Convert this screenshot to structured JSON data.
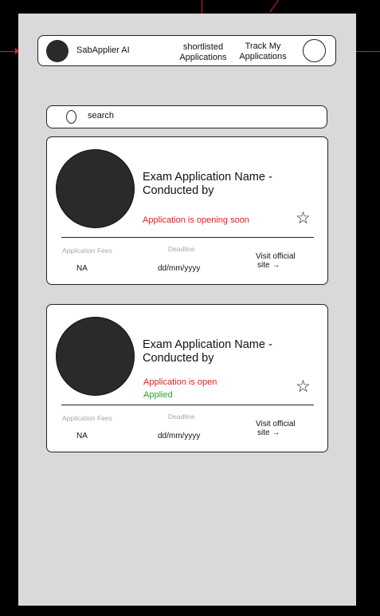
{
  "nav": {
    "brand": "SabApplier AI",
    "link_shortlisted_line1": "shortlisted",
    "link_shortlisted_line2": "Applications",
    "link_track_line1": "Track My",
    "link_track_line2": "Applications"
  },
  "search": {
    "placeholder": "search"
  },
  "cards": [
    {
      "title_line1": "Exam Application Name -",
      "title_line2": "Conducted by",
      "status": "Application is opening soon",
      "applied": "",
      "fees_label": "Application Fees",
      "fees_value": "NA",
      "deadline_label": "Deadline",
      "deadline_value": "dd/mm/yyyy",
      "visit_line1": "Visit official",
      "visit_line2": "site →",
      "star": "☆"
    },
    {
      "title_line1": "Exam Application Name -",
      "title_line2": "Conducted by",
      "status": "Application is open",
      "applied": "Applied",
      "fees_label": "Application Fees",
      "fees_value": "NA",
      "deadline_label": "Deadline",
      "deadline_value": "dd/mm/yyyy",
      "visit_line1": "Visit official",
      "visit_line2": "site →",
      "star": "☆"
    }
  ],
  "colors": {
    "accent_red": "#e02020",
    "applied_green": "#2aa02a",
    "connector_red": "#e01b24"
  }
}
